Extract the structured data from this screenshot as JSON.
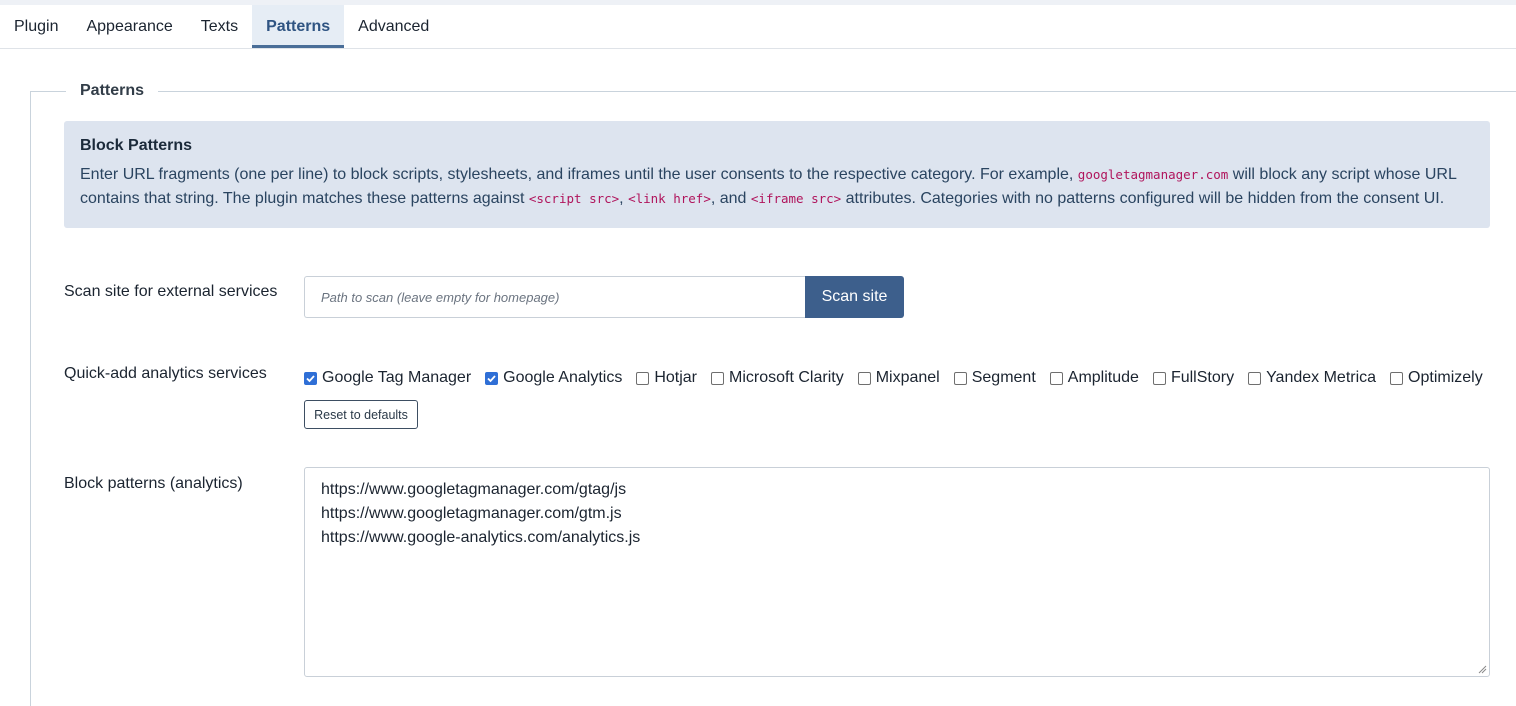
{
  "tabs": [
    {
      "label": "Plugin",
      "active": false
    },
    {
      "label": "Appearance",
      "active": false
    },
    {
      "label": "Texts",
      "active": false
    },
    {
      "label": "Patterns",
      "active": true
    },
    {
      "label": "Advanced",
      "active": false
    }
  ],
  "fieldset": {
    "legend": "Patterns"
  },
  "alert": {
    "title": "Block Patterns",
    "text_1": "Enter URL fragments (one per line) to block scripts, stylesheets, and iframes until the user consents to the respective category. For example, ",
    "code_1": "googletagmanager.com",
    "text_2": " will block any script whose URL contains that string. The plugin matches these patterns against ",
    "code_2": "<script src>",
    "text_3": ", ",
    "code_3": "<link href>",
    "text_4": ", and ",
    "code_4": "<iframe src>",
    "text_5": " attributes. Categories with no patterns configured will be hidden from the consent UI."
  },
  "scan": {
    "label": "Scan site for external services",
    "placeholder": "Path to scan (leave empty for homepage)",
    "button_label": "Scan site"
  },
  "quick_add": {
    "label": "Quick-add analytics services",
    "services": [
      {
        "name": "Google Tag Manager",
        "checked": true
      },
      {
        "name": "Google Analytics",
        "checked": true
      },
      {
        "name": "Hotjar",
        "checked": false
      },
      {
        "name": "Microsoft Clarity",
        "checked": false
      },
      {
        "name": "Mixpanel",
        "checked": false
      },
      {
        "name": "Segment",
        "checked": false
      },
      {
        "name": "Amplitude",
        "checked": false
      },
      {
        "name": "FullStory",
        "checked": false
      },
      {
        "name": "Yandex Metrica",
        "checked": false
      },
      {
        "name": "Optimizely",
        "checked": false
      }
    ],
    "reset_label": "Reset to defaults"
  },
  "block_patterns": {
    "label": "Block patterns (analytics)",
    "lines": [
      "https://www.googletagmanager.com/gtag/js",
      "https://www.googletagmanager.com/gtm.js",
      "https://www.google-analytics.com/analytics.js"
    ]
  },
  "colors": {
    "accent": "#3d5f8c",
    "alert_bg": "#dde4ef",
    "code": "#b0145c",
    "checkbox_checked": "#2f6fd6"
  }
}
